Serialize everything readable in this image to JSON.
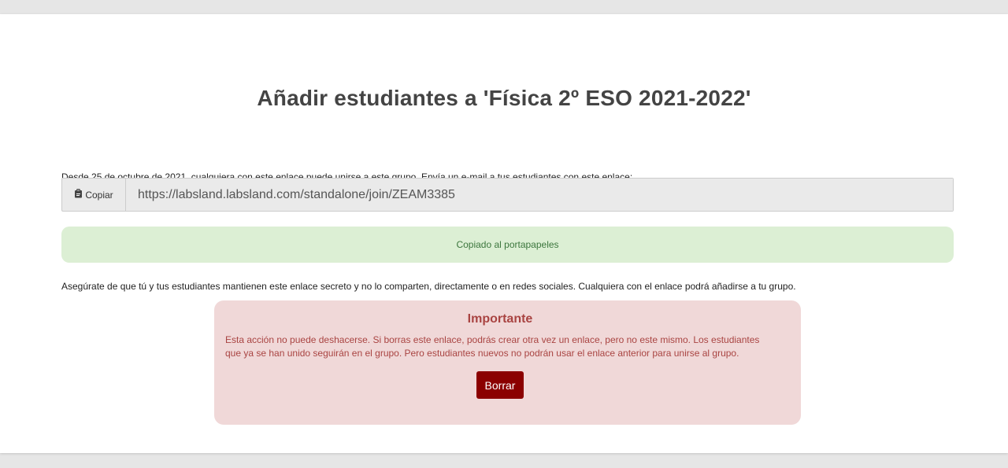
{
  "page": {
    "title": "Añadir estudiantes a 'Física 2º ESO 2021-2022'",
    "intro": "Desde 25 de octubre de 2021, cualquiera con este enlace puede unirse a este grupo. Envía un e-mail a tus estudiantes con este enlace:"
  },
  "link": {
    "copy_label": "Copiar",
    "copy_icon": "clipboard-icon",
    "url": "https://labsland.labsland.com/standalone/join/ZEAM3385"
  },
  "success": {
    "message": "Copiado al portapapeles"
  },
  "warning": {
    "text": "Asegúrate de que tú y tus estudiantes mantienen este enlace secreto y no lo comparten, directamente o en redes sociales. Cualquiera con el enlace podrá añadirse a tu grupo."
  },
  "danger": {
    "title": "Importante",
    "body": "Esta acción no puede deshacerse. Si borras este enlace, podrás crear otra vez un enlace, pero no este mismo. Los estudiantes que ya se han unido seguirán en el grupo. Pero estudiantes nuevos no podrán usar el enlace anterior para unirse al grupo.",
    "button_label": "Borrar"
  },
  "colors": {
    "success_bg": "#dcefd4",
    "success_text": "#3c763d",
    "danger_bg": "#f0d8d8",
    "danger_text": "#a94442",
    "danger_button": "#8b0000"
  }
}
